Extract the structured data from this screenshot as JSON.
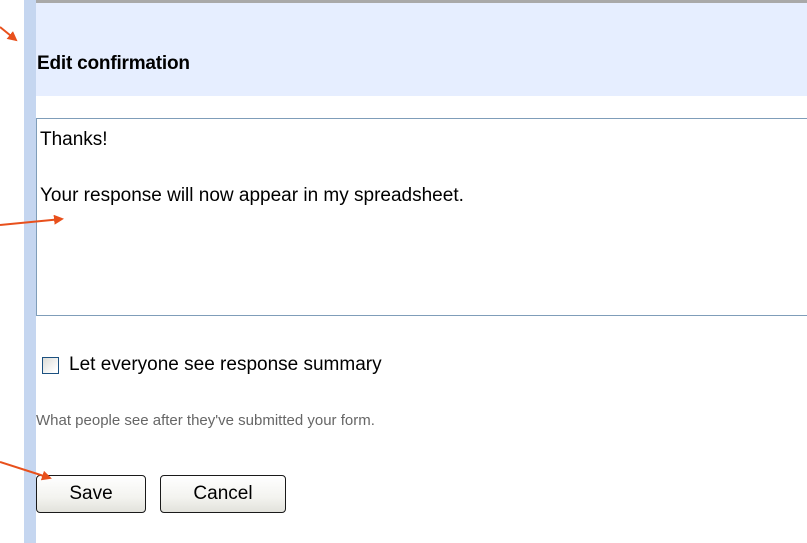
{
  "dialog": {
    "title": "Edit confirmation"
  },
  "confirmation": {
    "message": "Thanks!\n\nYour response will now appear in my spreadsheet."
  },
  "summary_checkbox": {
    "label": "Let everyone see response summary",
    "checked": false
  },
  "hint": {
    "text": "What people see after they've submitted your form."
  },
  "buttons": {
    "save_label": "Save",
    "cancel_label": "Cancel"
  },
  "colors": {
    "header_bg": "#e6eeff",
    "border_accent": "#c5d6f0",
    "annotation_arrow": "#e8501c"
  }
}
